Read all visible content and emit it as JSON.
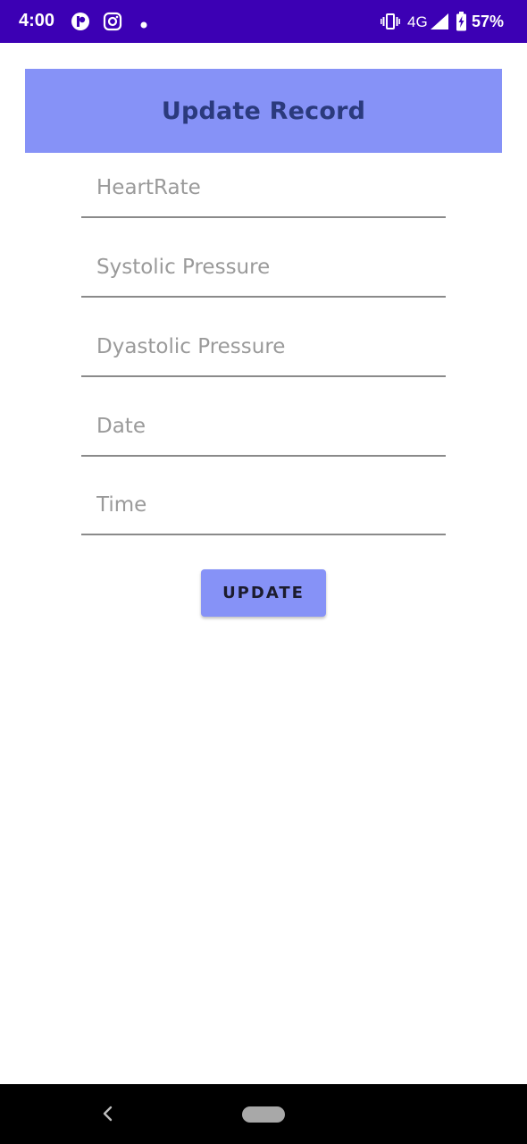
{
  "status_bar": {
    "time": "4:00",
    "network": "4G",
    "battery": "57%",
    "background_color": "#3c00b4",
    "icons": [
      "app-icon",
      "instagram-icon",
      "notification-dot-icon",
      "vibrate-icon",
      "signal-icon",
      "battery-icon"
    ]
  },
  "header": {
    "title": "Update Record",
    "background_color": "#8692f7",
    "title_color": "#2b3a7d"
  },
  "form": {
    "fields": [
      {
        "placeholder": "HeartRate",
        "value": ""
      },
      {
        "placeholder": "Systolic Pressure",
        "value": ""
      },
      {
        "placeholder": "Dyastolic Pressure",
        "value": ""
      },
      {
        "placeholder": "Date",
        "value": ""
      },
      {
        "placeholder": "Time",
        "value": ""
      }
    ],
    "submit_label": "UPDATE"
  },
  "nav_bar": {
    "icons": [
      "back-icon",
      "home-pill-icon"
    ]
  }
}
